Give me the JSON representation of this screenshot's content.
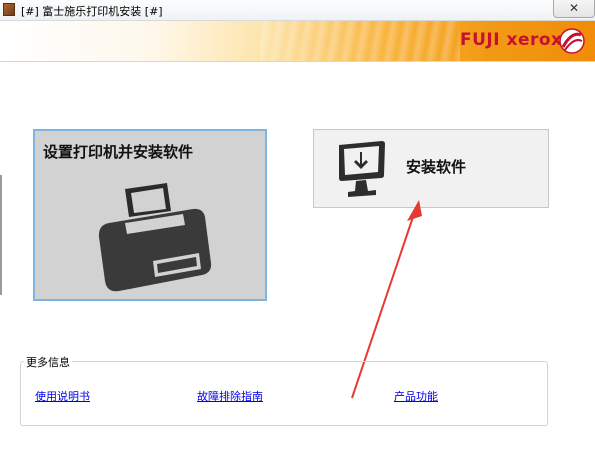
{
  "window": {
    "title": "[#] 富士施乐打印机安装 [#]",
    "close_glyph": "✕"
  },
  "banner": {
    "brand": "FUJI xerox",
    "colors": {
      "brand_red": "#c8102e",
      "banner_orange": "#f29a15"
    }
  },
  "tiles": [
    {
      "label": "设置打印机并安装软件",
      "icon": "printer-icon"
    },
    {
      "label": "安装软件",
      "icon": "monitor-download-icon"
    }
  ],
  "more_info": {
    "heading": "更多信息",
    "links": [
      "使用说明书",
      "故障排除指南",
      "产品功能"
    ]
  },
  "annotation": {
    "icon": "red-arrow-annotation",
    "color": "#e53935"
  }
}
